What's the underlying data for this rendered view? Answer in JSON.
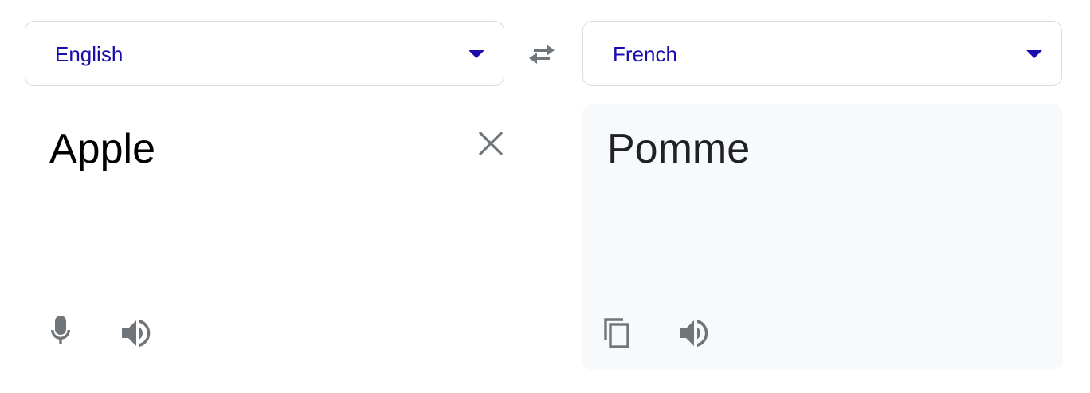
{
  "source": {
    "language": "English",
    "text": "Apple"
  },
  "target": {
    "language": "French",
    "text": "Pomme"
  },
  "icons": {
    "swap": "swap-languages-icon",
    "clear": "close-icon",
    "mic": "microphone-icon",
    "source_speaker": "speaker-icon",
    "copy": "copy-icon",
    "target_speaker": "speaker-icon"
  },
  "colors": {
    "language_text": "#1a0dab",
    "icon_gray": "#70757a",
    "result_panel_bg": "#f8f9fa",
    "border": "#dadce0"
  }
}
